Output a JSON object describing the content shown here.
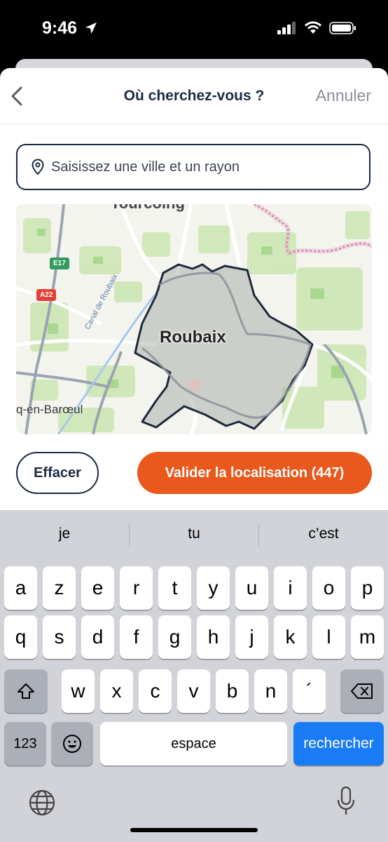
{
  "status": {
    "time": "9:46"
  },
  "nav": {
    "title": "Où cherchez-vous ?",
    "cancel_label": "Annuler"
  },
  "search": {
    "placeholder": "Saisissez une ville et un rayon",
    "value": ""
  },
  "map": {
    "city_label": "Roubaix",
    "sub_label": "q-en-Barœul",
    "top_label": "Tourcoing",
    "canal_label": "Canal de Roubaix",
    "road_e17": "E17",
    "road_a22": "A22"
  },
  "actions": {
    "clear_label": "Effacer",
    "validate_label": "Valider la localisation (447)"
  },
  "keyboard": {
    "suggestions": [
      "je",
      "tu",
      "c’est"
    ],
    "row1": [
      "a",
      "z",
      "e",
      "r",
      "t",
      "y",
      "u",
      "i",
      "o",
      "p"
    ],
    "row2": [
      "q",
      "s",
      "d",
      "f",
      "g",
      "h",
      "j",
      "k",
      "l",
      "m"
    ],
    "row3": [
      "w",
      "x",
      "c",
      "v",
      "b",
      "n",
      "´"
    ],
    "numbers_label": "123",
    "space_label": "espace",
    "return_label": "rechercher"
  },
  "colors": {
    "accent": "#e9581c",
    "navy": "#1d2a44",
    "key_blue": "#1a7cf5"
  }
}
